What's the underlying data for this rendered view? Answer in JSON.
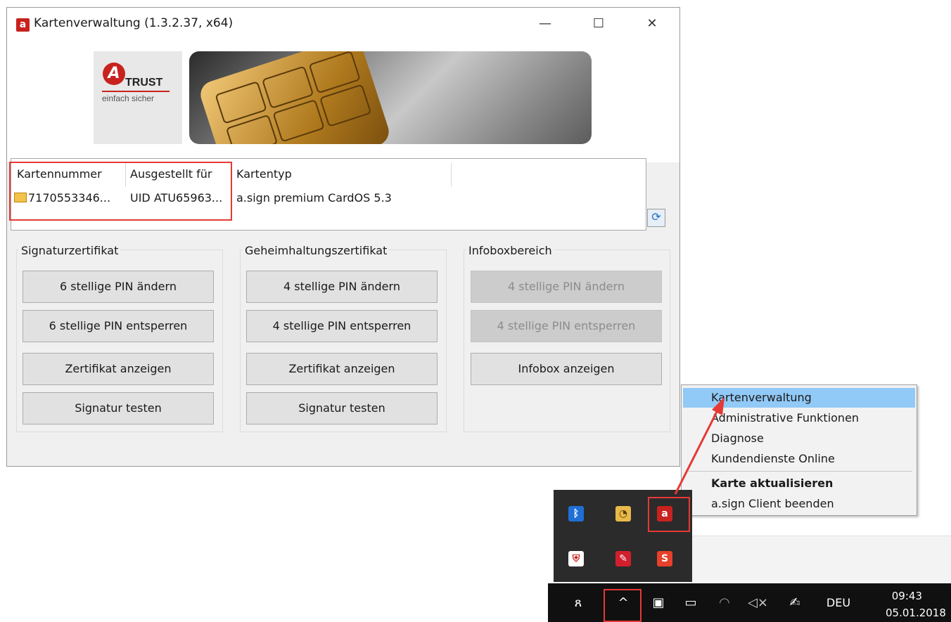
{
  "window": {
    "title": "Kartenverwaltung (1.3.2.37, x64)",
    "app_icon": "a",
    "controls": {
      "minimize": "—",
      "maximize": "☐",
      "close": "✕"
    }
  },
  "logo": {
    "mark": "A",
    "brand": "TRUST",
    "tagline": "einfach sicher"
  },
  "card_list": {
    "columns": [
      "Kartennummer",
      "Ausgestellt für",
      "Kartentyp"
    ],
    "rows": [
      {
        "number": "7170553346...",
        "issued_to": "UID ATU65963...",
        "type": "a.sign premium CardOS 5.3"
      }
    ],
    "refresh_icon": "⟳"
  },
  "groups": [
    {
      "title": "Signaturzertifikat",
      "buttons": [
        "6 stellige PIN ändern",
        "6 stellige PIN entsperren",
        "Zertifikat anzeigen",
        "Signatur testen"
      ]
    },
    {
      "title": "Geheimhaltungszertifikat",
      "buttons": [
        "4 stellige PIN ändern",
        "4 stellige PIN entsperren",
        "Zertifikat anzeigen",
        "Signatur testen"
      ]
    },
    {
      "title": "Infoboxbereich",
      "buttons": [
        "4 stellige PIN ändern",
        "4 stellige PIN entsperren",
        "Infobox anzeigen"
      ]
    }
  ],
  "context_menu": {
    "items": [
      "Kartenverwaltung",
      "Administrative Funktionen",
      "Diagnose",
      "Kundendienste Online",
      "Karte aktualisieren",
      "a.sign Client beenden"
    ],
    "highlighted_index": 0,
    "bold_index": 4
  },
  "tray": {
    "icons": [
      "bluetooth-icon",
      "sync-app-icon",
      "asign-icon",
      "defender-icon",
      "pdf-reader-icon",
      "snagit-icon"
    ],
    "glyphs": [
      "ᛒ",
      "◔",
      "a",
      "⛨",
      "✎",
      "S"
    ]
  },
  "taskbar": {
    "people_glyph": "ጸ",
    "chevron": "^",
    "language": "DEU",
    "time": "09:43",
    "date": "05.01.2018"
  },
  "colors": {
    "highlight_red": "#e53935",
    "menu_highlight": "#91c9f7",
    "brand_red": "#c8221f"
  }
}
